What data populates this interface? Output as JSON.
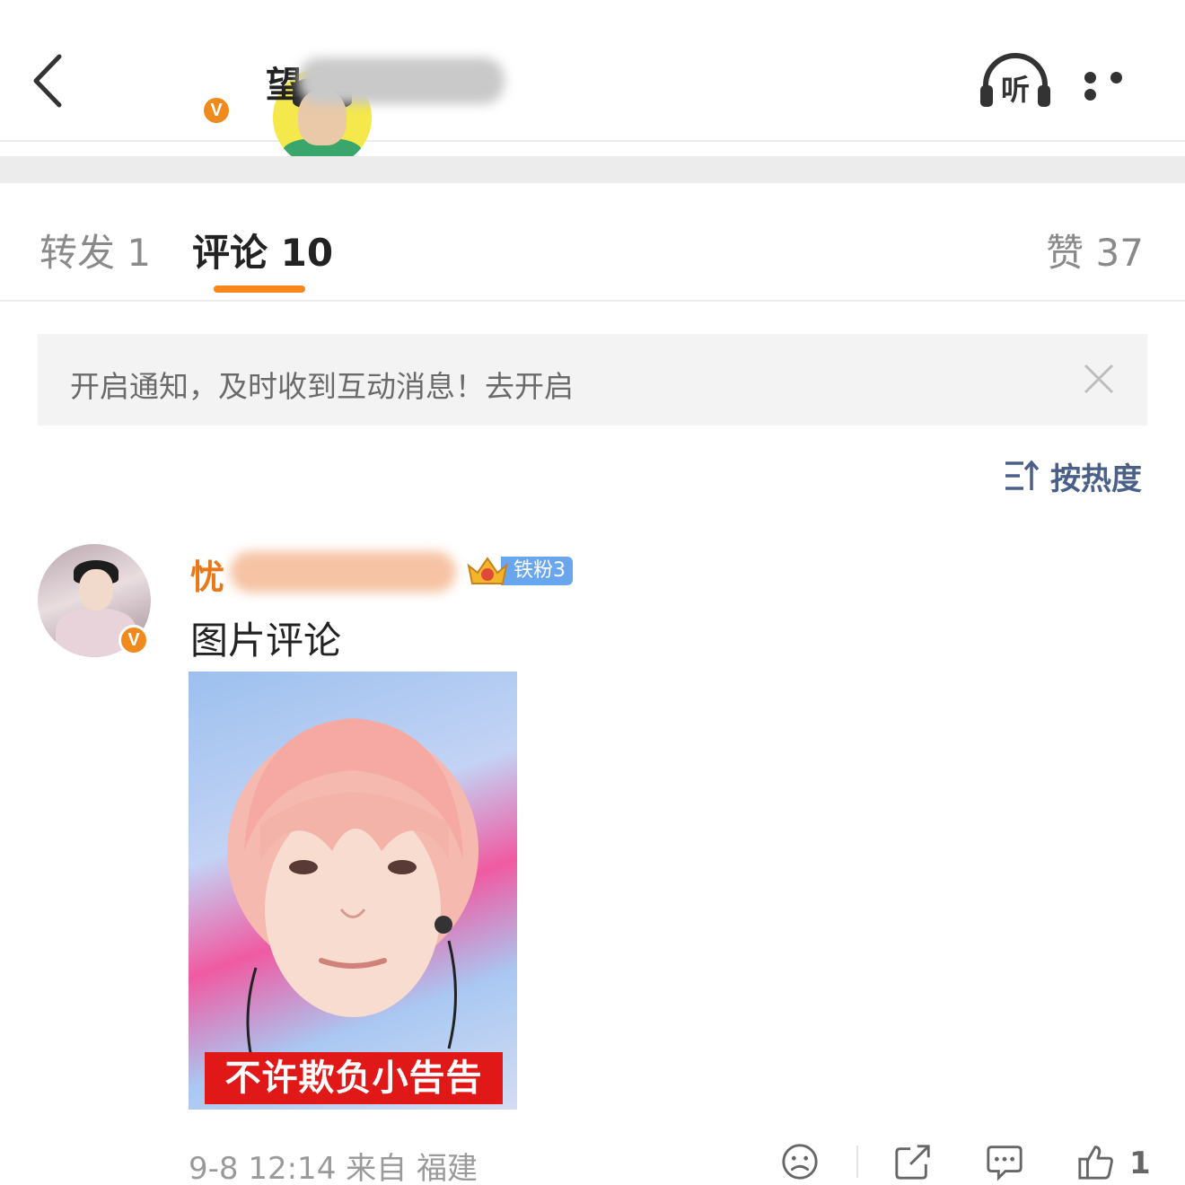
{
  "header": {
    "back_icon": "chevron-left-icon",
    "name_visible": "望",
    "listen_icon_label": "听",
    "more_icon": "more-dots-icon",
    "verified_mark": "V"
  },
  "tabs": {
    "repost_label": "转发",
    "repost_count": "1",
    "comment_label": "评论",
    "comment_count": "10",
    "like_label": "赞",
    "like_count": "37",
    "active_color": "#f7861c"
  },
  "notice": {
    "text": "开启通知，及时收到互动消息！去开启",
    "close_icon": "close-icon"
  },
  "sort": {
    "label": "按热度",
    "icon": "sort-icon"
  },
  "comment": {
    "user_visible": "忧",
    "user_color": "#e8781a",
    "verified_mark": "V",
    "fan_badge": "铁粉3",
    "text": "图片评论",
    "image_caption": "不许欺负小告告",
    "time": "9-8 12:14",
    "source_prefix": "来自",
    "location": "福建",
    "like_count": "1",
    "actions": [
      "sad-face-icon",
      "share-icon",
      "comment-icon",
      "thumbs-up-icon"
    ]
  }
}
